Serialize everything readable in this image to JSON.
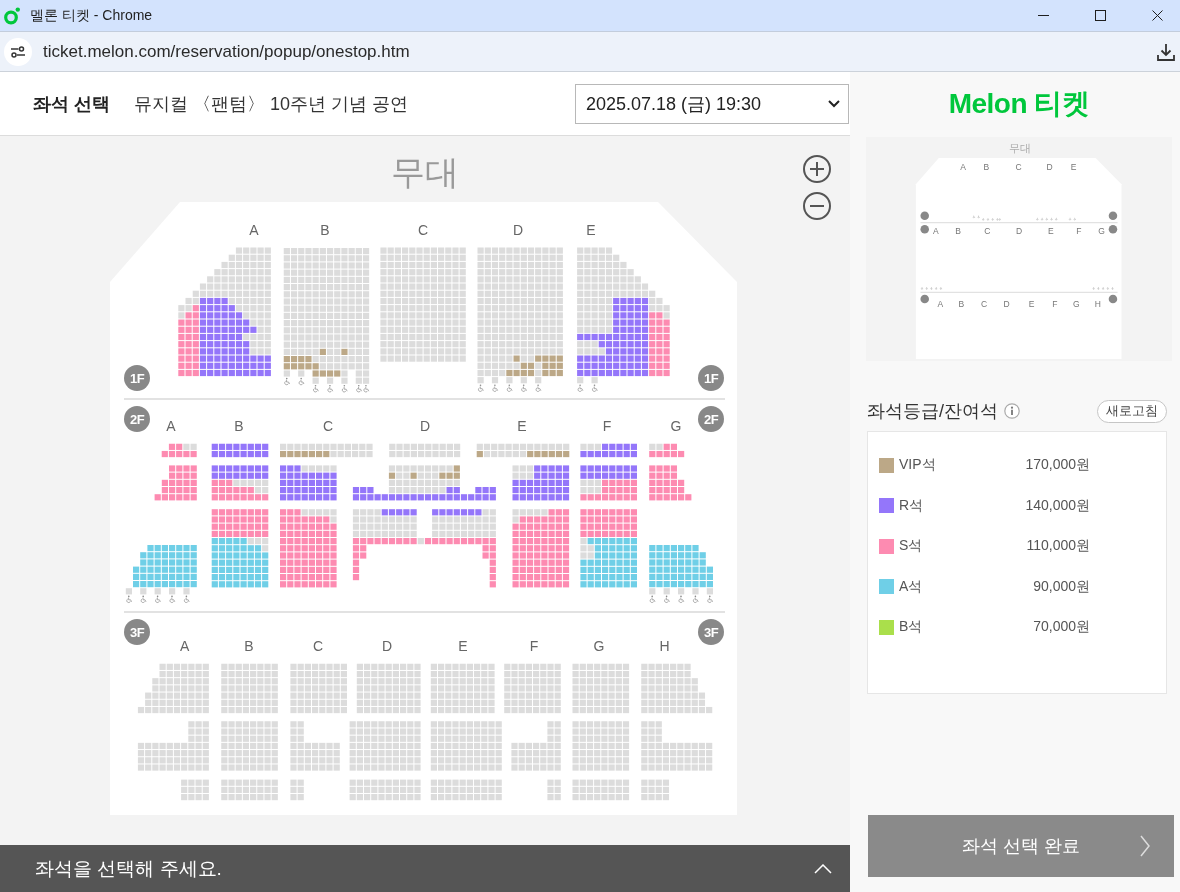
{
  "window": {
    "title": "멜론 티켓 - Chrome"
  },
  "address_bar": {
    "url": "ticket.melon.com/reservation/popup/onestop.htm"
  },
  "header": {
    "title": "좌석 선택",
    "performance": "뮤지컬 〈팬텀〉 10주년 기념 공연",
    "date_select": "2025.07.18 (금) 19:30"
  },
  "seat_map": {
    "stage": "무대",
    "floors": [
      {
        "badges": [
          "1F",
          "1F"
        ],
        "sections": [
          {
            "label": "A"
          },
          {
            "label": "B"
          },
          {
            "label": "C"
          },
          {
            "label": "D"
          },
          {
            "label": "E"
          }
        ]
      },
      {
        "badges": [
          "2F",
          "2F"
        ],
        "sections": [
          {
            "label": "A"
          },
          {
            "label": "B"
          },
          {
            "label": "C"
          },
          {
            "label": "D"
          },
          {
            "label": "E"
          },
          {
            "label": "F"
          },
          {
            "label": "G"
          }
        ]
      },
      {
        "badges": [
          "3F",
          "3F"
        ],
        "sections": [
          {
            "label": "A"
          },
          {
            "label": "B"
          },
          {
            "label": "C"
          },
          {
            "label": "D"
          },
          {
            "label": "E"
          },
          {
            "label": "F"
          },
          {
            "label": "G"
          },
          {
            "label": "H"
          }
        ]
      }
    ]
  },
  "logo": "Melon 티켓",
  "minimap": {
    "stage": "무대",
    "floors": [
      {
        "labels": [
          "A",
          "B",
          "C",
          "D",
          "E"
        ]
      },
      {
        "labels": [
          "A",
          "B",
          "C",
          "D",
          "E",
          "F",
          "G"
        ]
      },
      {
        "labels": [
          "A",
          "B",
          "C",
          "D",
          "E",
          "F",
          "G",
          "H"
        ]
      }
    ]
  },
  "grade_panel": {
    "title": "좌석등급/잔여석",
    "refresh_button": "새로고침",
    "grades": [
      {
        "name": "VIP석",
        "price": "170,000원",
        "color": "#bca887"
      },
      {
        "name": "R석",
        "price": "140,000원",
        "color": "#9476fa"
      },
      {
        "name": "S석",
        "price": "110,000원",
        "color": "#fd8bb1"
      },
      {
        "name": "A석",
        "price": "90,000원",
        "color": "#6fcfe7"
      },
      {
        "name": "B석",
        "price": "70,000원",
        "color": "#aadf4b"
      }
    ]
  },
  "confirm_button": "좌석 선택 완료",
  "status_bar": {
    "message": "좌석을 선택해 주세요."
  }
}
